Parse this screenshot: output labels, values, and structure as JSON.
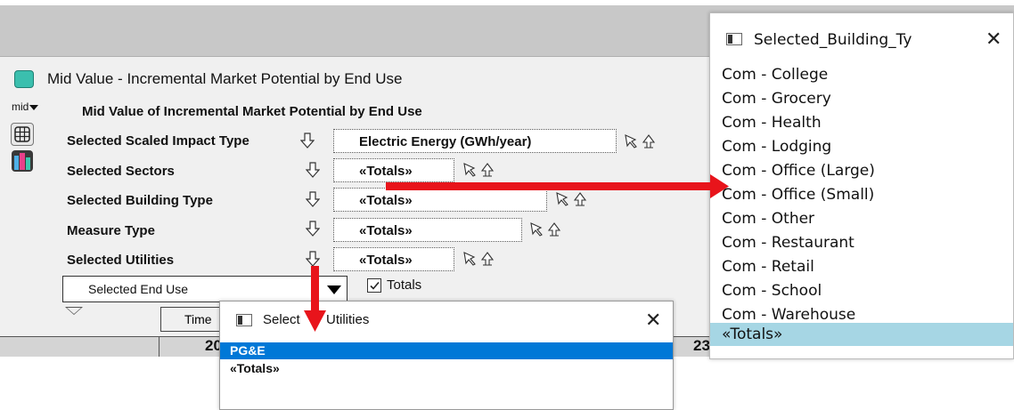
{
  "main_window": {
    "title": "Mid Value - Incremental Market Potential by End Use",
    "mid_menu": "mid",
    "heading": "Mid Value of Incremental Market Potential by End Use",
    "rows": [
      {
        "label": "Selected Scaled Impact Type",
        "value": "Electric Energy (GWh/year)"
      },
      {
        "label": "Selected Sectors",
        "value": "«Totals»"
      },
      {
        "label": "Selected Building Type",
        "value": "«Totals»"
      },
      {
        "label": "Measure Type",
        "value": "«Totals»"
      },
      {
        "label": "Selected Utilities",
        "value": "«Totals»"
      }
    ],
    "end_use_dropdown": "Selected End Use",
    "totals_checkbox": {
      "label": "Totals",
      "checked": true
    },
    "time_button": "Time",
    "grid_partial_left": "20",
    "grid_partial_right": "23"
  },
  "utilities_popup": {
    "title": "Selected_Utilities",
    "title_visible_left": "Select",
    "title_visible_right": "Utilities",
    "items": [
      "PG&E",
      "«Totals»"
    ],
    "selected_index": 0
  },
  "building_popup": {
    "title": "Selected_Building_Ty",
    "items": [
      "Com - College",
      "Com - Grocery",
      "Com - Health",
      "Com - Lodging",
      "Com - Office (Large)",
      "Com - Office (Small)",
      "Com - Other",
      "Com - Restaurant",
      "Com - Retail",
      "Com - School",
      "Com - Warehouse",
      "«Totals»"
    ],
    "selected_index": 11
  },
  "colors": {
    "annotation_arrow": "#e8141b",
    "selection_blue": "#0078d7",
    "selection_light": "#a6d6e4",
    "window_icon": "#3bbfae"
  }
}
